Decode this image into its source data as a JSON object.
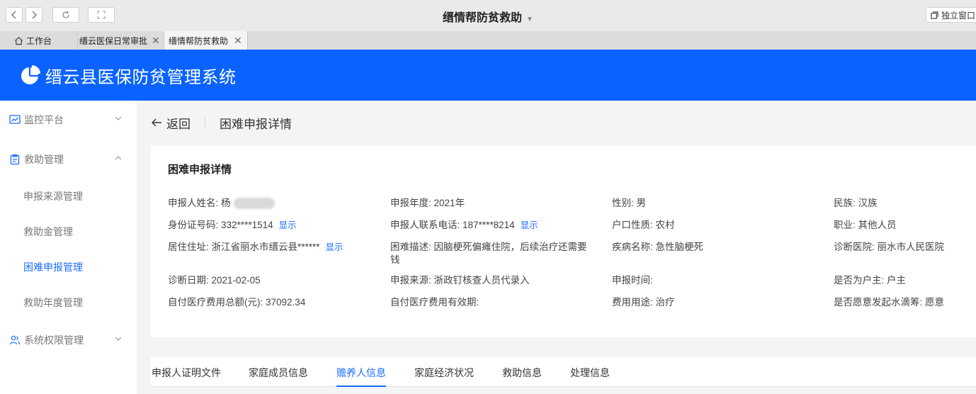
{
  "browser": {
    "window_title": "缙情帮防贫救助",
    "standalone_label": "独立窗口",
    "tabs": [
      {
        "label": "工作台",
        "icon": "home-icon"
      },
      {
        "label": "缙云医保日常审批",
        "closable": true
      },
      {
        "label": "缙情帮防贫救助",
        "closable": true
      }
    ]
  },
  "app": {
    "title": "缙云县医保防贫管理系统",
    "accent": "#0a63ff"
  },
  "sidebar": {
    "groups": [
      {
        "label": "监控平台",
        "icon": "monitor-chart-icon",
        "expanded": false
      },
      {
        "label": "救助管理",
        "icon": "clipboard-icon",
        "expanded": true
      },
      {
        "label": "系统权限管理",
        "icon": "users-icon",
        "expanded": false
      }
    ],
    "items": [
      {
        "label": "申报来源管理"
      },
      {
        "label": "救助金管理"
      },
      {
        "label": "困难申报管理",
        "active": true
      },
      {
        "label": "救助年度管理"
      }
    ]
  },
  "page": {
    "back_label": "返回",
    "title": "困难申报详情"
  },
  "detail": {
    "card_title": "困难申报详情",
    "show_label": "显示",
    "fields": {
      "applicant_name": {
        "label": "申报人姓名:",
        "value": "杨"
      },
      "year": {
        "label": "申报年度:",
        "value": "2021年"
      },
      "gender": {
        "label": "性别:",
        "value": "男"
      },
      "ethnicity": {
        "label": "民族:",
        "value": "汉族"
      },
      "id_number": {
        "label": "身份证号码:",
        "value": "332****1514"
      },
      "phone": {
        "label": "申报人联系电话:",
        "value": "187****8214"
      },
      "hukou": {
        "label": "户口性质:",
        "value": "农村"
      },
      "occupation": {
        "label": "职业:",
        "value": "其他人员"
      },
      "address": {
        "label": "居住住址:",
        "value": "浙江省丽水市缙云县******"
      },
      "difficulty": {
        "label": "困难描述:",
        "value": "因脑梗死偏瘫住院，后续治疗还需要钱"
      },
      "disease": {
        "label": "疾病名称:",
        "value": "急性脑梗死"
      },
      "hospital": {
        "label": "诊断医院:",
        "value": "丽水市人民医院"
      },
      "diagnosis_date": {
        "label": "诊断日期:",
        "value": "2021-02-05"
      },
      "source": {
        "label": "申报来源:",
        "value": "浙政钉核查人员代录入"
      },
      "report_time": {
        "label": "申报时间:",
        "value": ""
      },
      "head_of_household": {
        "label": "是否为户主:",
        "value": "户主"
      },
      "self_paid_total": {
        "label": "自付医疗费用总额(元):",
        "value": "37092.34"
      },
      "self_paid_valid": {
        "label": "自付医疗费用有效期:",
        "value": ""
      },
      "fee_usage": {
        "label": "费用用途:",
        "value": "治疗"
      },
      "water_drop": {
        "label": "是否愿意发起水滴筹:",
        "value": "愿意"
      }
    }
  },
  "subtabs": [
    {
      "label": "申报人证明文件"
    },
    {
      "label": "家庭成员信息"
    },
    {
      "label": "赡养人信息",
      "active": true
    },
    {
      "label": "家庭经济状况"
    },
    {
      "label": "救助信息"
    },
    {
      "label": "处理信息"
    }
  ]
}
